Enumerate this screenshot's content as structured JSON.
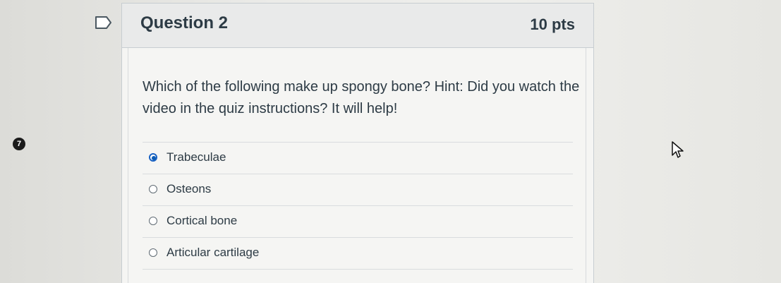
{
  "question": {
    "number_badge": "7",
    "title": "Question 2",
    "points": "10 pts",
    "text": "Which of the following make up spongy bone? Hint: Did you watch the video in the quiz instructions? It will help!",
    "answers": [
      {
        "label": "Trabeculae",
        "selected": true
      },
      {
        "label": "Osteons",
        "selected": false
      },
      {
        "label": "Cortical bone",
        "selected": false
      },
      {
        "label": "Articular cartilage",
        "selected": false
      }
    ]
  },
  "icons": {
    "flag": "flag-question-icon",
    "cursor": "mouse-pointer-icon",
    "selected_radio": "radio-selected-icon",
    "unselected_radio": "radio-unselected-icon"
  },
  "colors": {
    "background": "#eeeeeb",
    "card_header": "#e9eaea",
    "border": "#c7cdd1",
    "text": "#2d3b45",
    "selected_radio": "#0b5bb5"
  }
}
